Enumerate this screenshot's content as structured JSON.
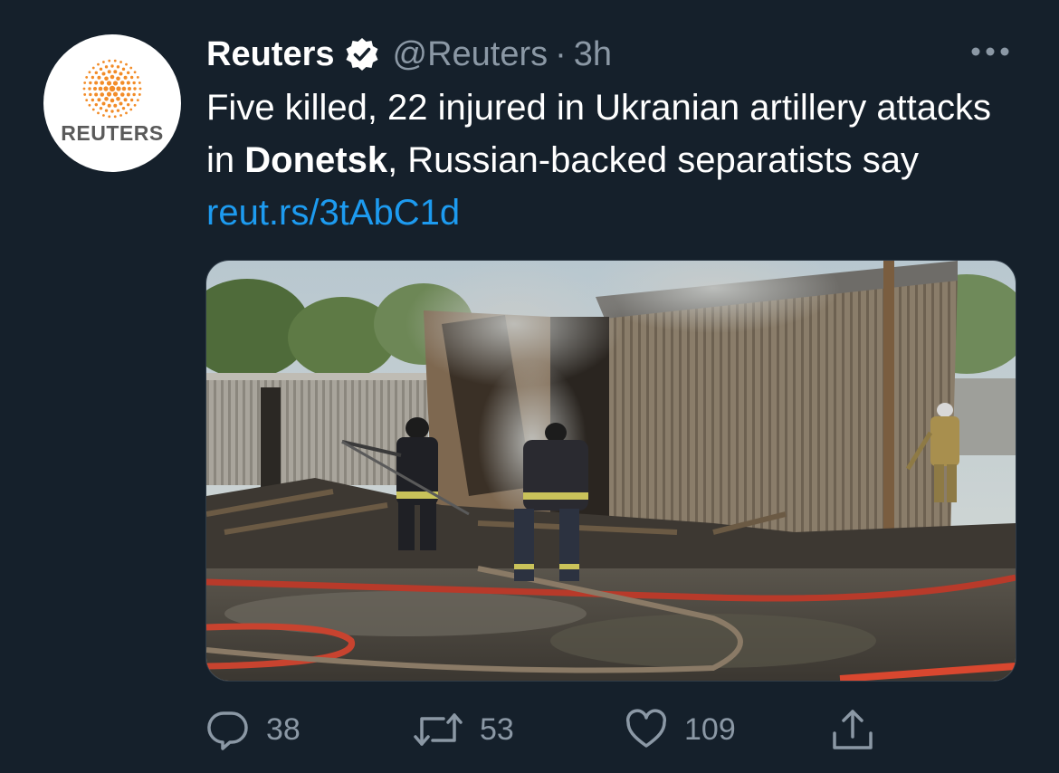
{
  "account": {
    "logo_text": "REUTERS",
    "name": "Reuters",
    "handle": "@Reuters",
    "separator": "·",
    "time": "3h"
  },
  "tweet": {
    "text_before": "Five killed, 22 injured in Ukranian artillery attacks in ",
    "text_bold": "Donetsk",
    "text_after": ", Russian-backed separatists say ",
    "link": "reut.rs/3tAbC1d"
  },
  "actions": {
    "replies": "38",
    "retweets": "53",
    "likes": "109"
  },
  "icons": {
    "more": "more-dots-icon",
    "reply": "reply-icon",
    "retweet": "retweet-icon",
    "like": "heart-icon",
    "share": "share-icon",
    "verified": "verified-badge-icon"
  },
  "colors": {
    "background": "#15202b",
    "text": "#ffffff",
    "secondary": "#8b98a5",
    "link": "#1d9bf0",
    "brand_orange": "#f28c28"
  }
}
